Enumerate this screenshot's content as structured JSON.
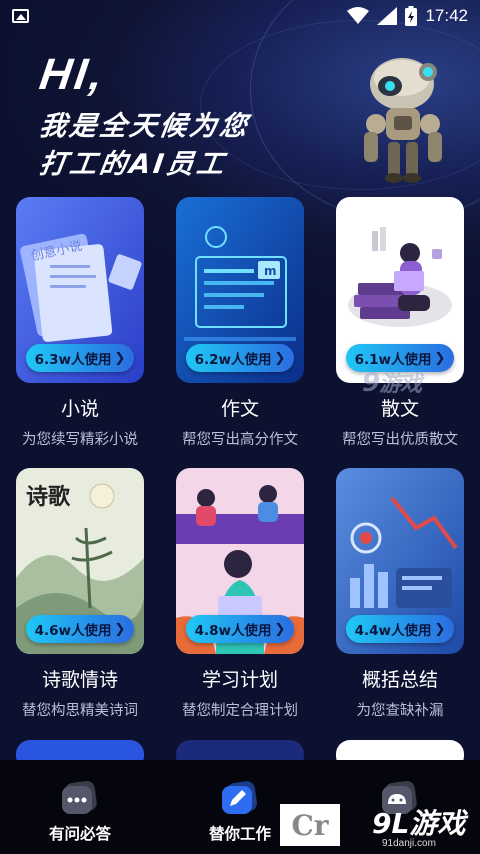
{
  "status_bar": {
    "time": "17:42"
  },
  "hero": {
    "greeting": "HI,",
    "line1": "我是全天候为您",
    "line2": "打工的AI员工"
  },
  "cards": [
    {
      "title": "小说",
      "usage": "6.3w人使用",
      "desc": "为您续写精彩小说",
      "art_text": "创意小说"
    },
    {
      "title": "作文",
      "usage": "6.2w人使用",
      "desc": "帮您写出高分作文"
    },
    {
      "title": "散文",
      "usage": "6.1w人使用",
      "desc": "帮您写出优质散文"
    },
    {
      "title": "诗歌情诗",
      "usage": "4.6w人使用",
      "desc": "替您构思精美诗词",
      "art_text": "诗歌"
    },
    {
      "title": "学习计划",
      "usage": "4.8w人使用",
      "desc": "替您制定合理计划"
    },
    {
      "title": "概括总结",
      "usage": "4.4w人使用",
      "desc": "为您查缺补漏"
    }
  ],
  "watermark_mid": {
    "num": "9",
    "text": "游戏"
  },
  "bottom_nav": [
    {
      "label": "有问必答",
      "icon": "chat-bubble-icon"
    },
    {
      "label": "替你工作",
      "icon": "edit-pen-icon"
    },
    {
      "label": "",
      "icon": "android-robot-icon"
    }
  ],
  "watermark_corner": {
    "cr": "Cr",
    "brand": "9L游戏",
    "site": "91danji.com"
  }
}
